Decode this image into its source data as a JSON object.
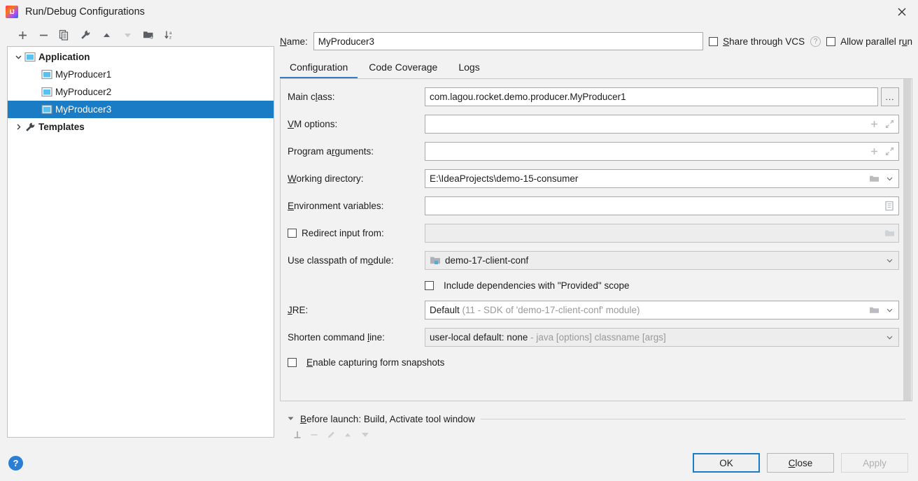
{
  "window": {
    "title": "Run/Debug Configurations",
    "app_icon": "intellij-idea-icon",
    "close_icon": "close-icon"
  },
  "tree_toolbar": {
    "buttons": [
      {
        "name": "add-configuration-button",
        "icon": "plus-icon",
        "enabled": true
      },
      {
        "name": "remove-configuration-button",
        "icon": "minus-icon",
        "enabled": true
      },
      {
        "name": "copy-configuration-button",
        "icon": "copy-icon",
        "enabled": true
      },
      {
        "name": "edit-templates-button",
        "icon": "wrench-icon",
        "enabled": true
      },
      {
        "name": "move-up-button",
        "icon": "arrow-up-icon",
        "enabled": true
      },
      {
        "name": "move-down-button",
        "icon": "arrow-down-icon",
        "enabled": false
      },
      {
        "name": "move-into-folder-button",
        "icon": "folder-add-icon",
        "enabled": true
      },
      {
        "name": "sort-alphabetically-button",
        "icon": "sort-az-icon",
        "enabled": true
      }
    ]
  },
  "tree": {
    "items": [
      {
        "label": "Application",
        "icon": "application-icon",
        "twisty": "chevron-down-icon",
        "bold": true,
        "depth": 0,
        "selected": false
      },
      {
        "label": "MyProducer1",
        "icon": "run-config-icon",
        "twisty": "",
        "bold": false,
        "depth": 1,
        "selected": false
      },
      {
        "label": "MyProducer2",
        "icon": "run-config-icon",
        "twisty": "",
        "bold": false,
        "depth": 1,
        "selected": false
      },
      {
        "label": "MyProducer3",
        "icon": "run-config-icon",
        "twisty": "",
        "bold": false,
        "depth": 1,
        "selected": true
      },
      {
        "label": "Templates",
        "icon": "wrench-icon",
        "twisty": "chevron-right-icon",
        "bold": true,
        "depth": 0,
        "selected": false
      }
    ]
  },
  "header": {
    "name_label": "Name:",
    "name_label_mnemonic": "N",
    "name_value": "MyProducer3",
    "share_vcs_label": "Share through VCS",
    "share_vcs_mnemonic": "S",
    "share_vcs_checked": false,
    "help_icon": "question-mark-icon",
    "allow_parallel_label": "Allow parallel run",
    "allow_parallel_mnemonic": "u",
    "allow_parallel_checked": false
  },
  "tabs": [
    {
      "label": "Configuration",
      "active": true
    },
    {
      "label": "Code Coverage",
      "active": false
    },
    {
      "label": "Logs",
      "active": false
    }
  ],
  "form": {
    "main_class": {
      "label_pre": "Main c",
      "label_mn": "l",
      "label_post": "ass:",
      "value": "com.lagou.rocket.demo.producer.MyProducer1",
      "browse_label": "...",
      "browse_icon": "ellipsis-button"
    },
    "vm_options": {
      "label_mn": "V",
      "label_post": "M options:",
      "value": "",
      "icons": [
        "plus-icon",
        "expand-diagonal-icon"
      ]
    },
    "program_arguments": {
      "label_pre": "Program a",
      "label_mn": "r",
      "label_post": "guments:",
      "value": "",
      "icons": [
        "plus-icon",
        "expand-diagonal-icon"
      ]
    },
    "working_directory": {
      "label_mn": "W",
      "label_post": "orking directory:",
      "value": "E:\\IdeaProjects\\demo-15-consumer",
      "icons": [
        "folder-icon",
        "chevron-down-icon"
      ]
    },
    "environment_variables": {
      "label_mn": "E",
      "label_post": "nvironment variables:",
      "value": "",
      "icons": [
        "list-browse-icon"
      ]
    },
    "redirect_input": {
      "label": "Redirect input from:",
      "checked": false,
      "value": "",
      "disabled": true,
      "icons": [
        "folder-icon"
      ]
    },
    "classpath_module": {
      "label_pre": "Use classpath of m",
      "label_mn": "o",
      "label_post": "dule:",
      "value": "demo-17-client-conf",
      "value_icon": "module-icon",
      "icons": [
        "chevron-down-icon"
      ]
    },
    "include_provided": {
      "label": "Include dependencies with \"Provided\" scope",
      "checked": false
    },
    "jre": {
      "label_mn": "J",
      "label_post": "RE:",
      "value": "Default",
      "value_hint": "(11 - SDK of 'demo-17-client-conf' module)",
      "icons": [
        "folder-icon",
        "chevron-down-icon"
      ]
    },
    "shorten_command_line": {
      "label_pre": "Shorten command ",
      "label_mn": "l",
      "label_post": "ine:",
      "value": "user-local default: none",
      "value_hint": "- java [options] classname [args]",
      "icons": [
        "chevron-down-icon"
      ]
    },
    "enable_snapshots": {
      "label_mn": "E",
      "label_post": "nable capturing form snapshots",
      "checked": false
    }
  },
  "before_launch": {
    "twisty": "triangle-down-icon",
    "label_mn": "B",
    "label_post": "efore launch: Build, Activate tool window",
    "toolbar": [
      {
        "name": "add-task-button",
        "icon": "plus-icon"
      },
      {
        "name": "remove-task-button",
        "icon": "minus-icon"
      },
      {
        "name": "edit-task-button",
        "icon": "pencil-icon"
      },
      {
        "name": "task-move-up-button",
        "icon": "arrow-up-icon"
      },
      {
        "name": "task-move-down-button",
        "icon": "arrow-down-icon"
      }
    ]
  },
  "footer": {
    "help_icon_label": "?",
    "ok_label": "OK",
    "close_label": "Close",
    "close_mnemonic": "C",
    "apply_label": "Apply",
    "apply_enabled": false
  },
  "colors": {
    "selection_blue": "#1a7cc4",
    "accent_blue": "#3a7cc4",
    "help_blue": "#2a7fd4",
    "dialog_bg": "#f2f2f2",
    "field_bg": "#ffffff",
    "hint_gray": "#9a9a9a"
  }
}
